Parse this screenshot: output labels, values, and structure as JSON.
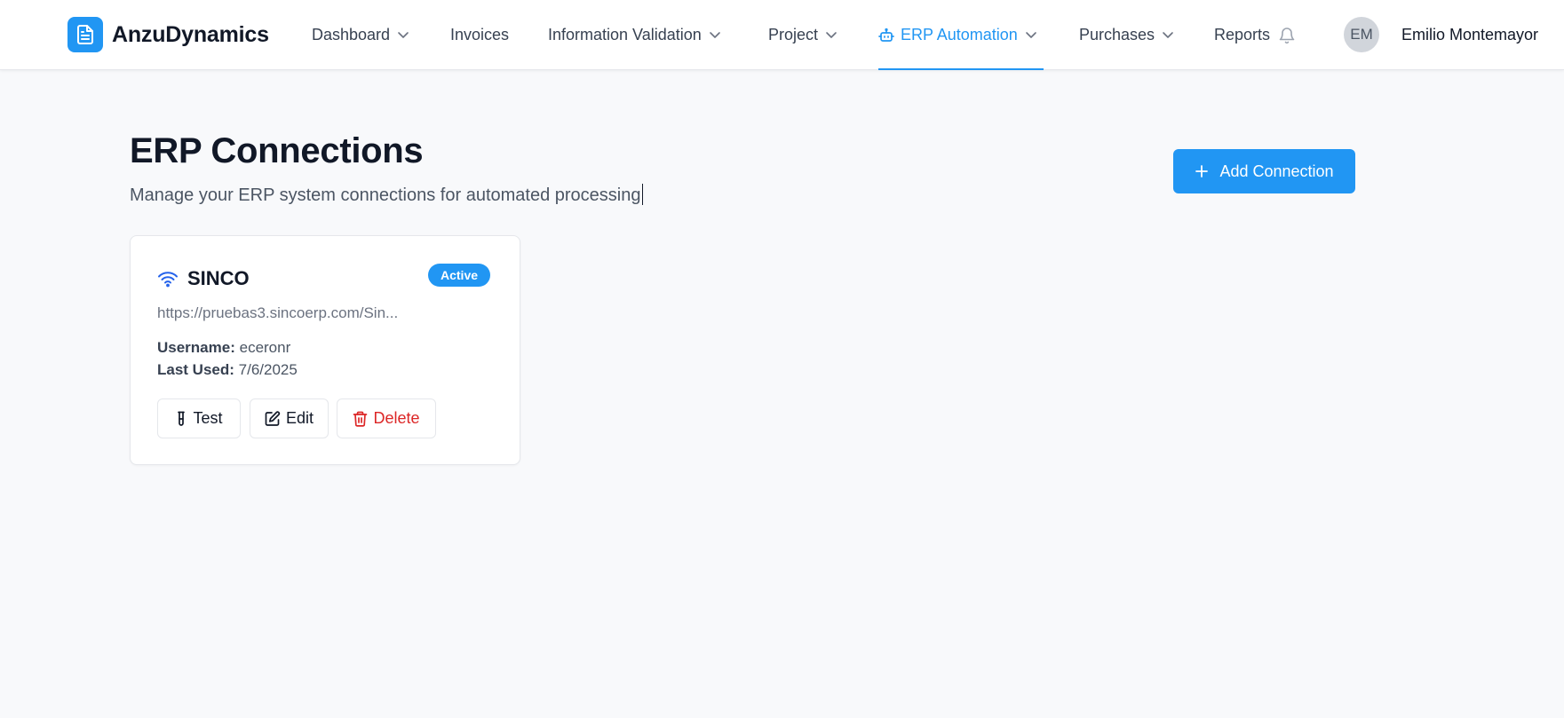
{
  "app": {
    "name": "AnzuDynamics",
    "logo_icon": "document-icon"
  },
  "nav": {
    "items": [
      {
        "label": "Dashboard",
        "has_dropdown": true
      },
      {
        "label": "Invoices",
        "has_dropdown": false
      },
      {
        "label": "Information Validation",
        "has_dropdown": true
      },
      {
        "label": "Project",
        "has_dropdown": true
      },
      {
        "label": "ERP Automation",
        "has_dropdown": true,
        "active": true,
        "icon": "robot-icon"
      },
      {
        "label": "Purchases",
        "has_dropdown": true
      },
      {
        "label": "Reports",
        "has_dropdown": false,
        "icon": "bell-icon"
      }
    ]
  },
  "user": {
    "initials": "EM",
    "name": "Emilio Montemayor"
  },
  "page": {
    "title": "ERP Connections",
    "subtitle": "Manage your ERP system connections for automated processing",
    "add_button_label": "Add Connection"
  },
  "connections": [
    {
      "name": "SINCO",
      "status": "Active",
      "url": "https://pruebas3.sincoerp.com/Sin...",
      "username_label": "Username:",
      "username": "eceronr",
      "last_used_label": "Last Used:",
      "last_used": "7/6/2025",
      "actions": {
        "test_label": "Test",
        "edit_label": "Edit",
        "delete_label": "Delete"
      }
    }
  ],
  "colors": {
    "accent": "#2196f3",
    "danger": "#dc2626",
    "background": "#f8f9fb"
  }
}
